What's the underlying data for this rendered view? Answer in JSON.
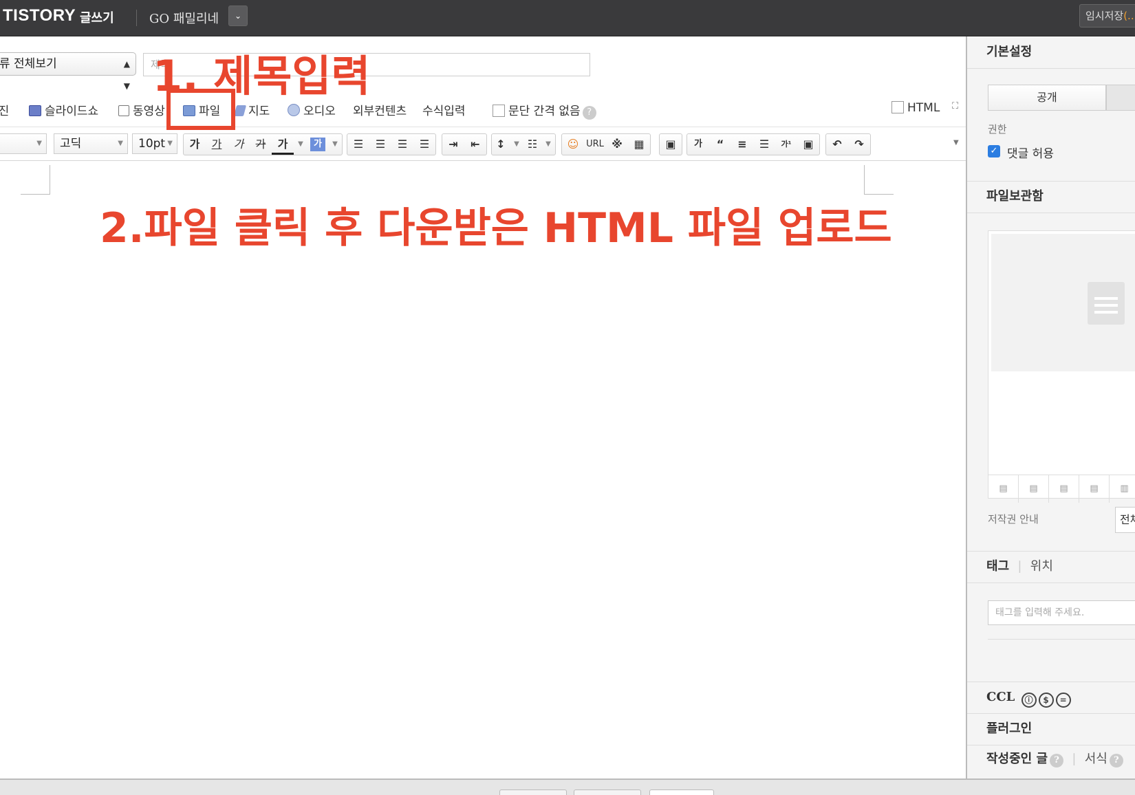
{
  "topbar": {
    "logo": "TISTORY",
    "logo_sub": "글쓰기",
    "blog_name": "GO 패밀리네",
    "dropdown_glyph": "⌄",
    "temp_save": "임시저장",
    "temp_save_count": "(.."
  },
  "editor": {
    "category": "류 전체보기",
    "title_placeholder": "제목",
    "toolbar1": {
      "photo": "사진",
      "slideshow": "슬라이드쇼",
      "video": "동영상",
      "file": "파일",
      "map": "지도",
      "audio": "오디오",
      "external": "외부컨텐츠",
      "formula": "수식입력",
      "no_paragraph_gap": "문단 간격 없음",
      "html": "HTML"
    },
    "toolbar2": {
      "font": "고딕",
      "size": "10pt",
      "url": "URL"
    }
  },
  "annotations": {
    "step1": "1. 제목입력",
    "step2": "2.파일 클릭 후 다운받은 HTML 파일 업로드",
    "color": "#e8462e"
  },
  "sidebar": {
    "basic_settings": "기본설정",
    "public": "공개",
    "permission": "권한",
    "allow_comments": "댓글 허용",
    "file_storage": "파일보관함",
    "copyright": "저작권 안내",
    "copyright_value": "전체",
    "tag": "태그",
    "location": "위치",
    "tag_placeholder": "태그를 입력해 주세요.",
    "ccl": "CCL",
    "plugin": "플러그인",
    "writing": "작성중인 글",
    "template": "서식"
  }
}
